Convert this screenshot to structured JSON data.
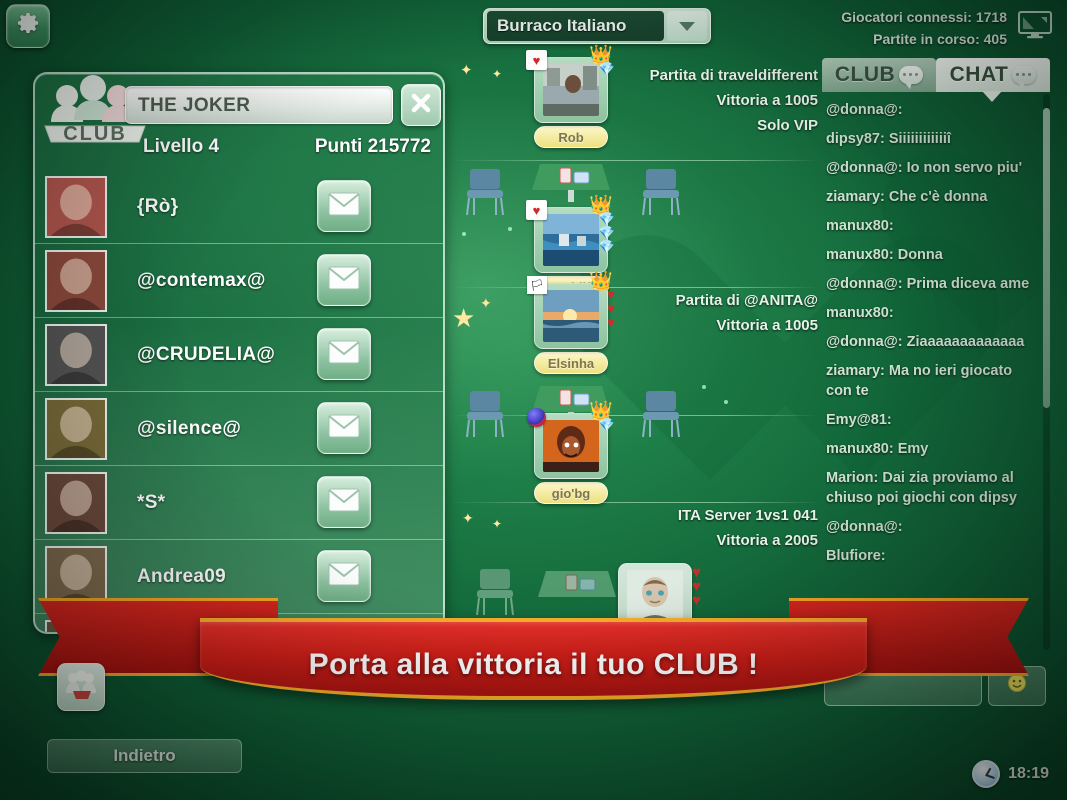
{
  "topbar": {
    "settings_icon": "gear-icon",
    "game_selector": {
      "value": "Burraco Italiano",
      "chevron_icon": "chevron-down-icon"
    },
    "stats": {
      "players_online": "Giocatori connessi: 1718",
      "games_running": "Partite in corso: 405"
    },
    "monitor_icon": "monitor-icon"
  },
  "club_panel": {
    "badge_label": "CLUB",
    "badge_icon": "club-people-icon",
    "club_name": "THE JOKER",
    "close_icon": "close-icon",
    "level": "Livello 4",
    "points": "Punti 215772",
    "mail_icon": "envelope-icon",
    "lamp_icon": "lamp-status-icon",
    "members": [
      {
        "name": "{Rò}",
        "online": true,
        "avatar_tone": "#b4584f"
      },
      {
        "name": "@contemax@",
        "online": false,
        "avatar_tone": "#8e4a3d"
      },
      {
        "name": "@CRUDELIA@",
        "online": true,
        "avatar_tone": "#555555"
      },
      {
        "name": "@silence@",
        "online": false,
        "avatar_tone": "#7a6c3a"
      },
      {
        "name": "*S*",
        "online": true,
        "avatar_tone": "#6b4a3c"
      },
      {
        "name": "Andrea09",
        "online": true,
        "avatar_tone": "#7d6a4e"
      },
      {
        "name": "",
        "online": false,
        "avatar_tone": "#6a5a44"
      }
    ]
  },
  "lobby": {
    "tables": [
      {
        "info": [
          "Partita di traveldifferent",
          "Vittoria a 1005",
          "Solo VIP"
        ],
        "host": {
          "name": "Rob",
          "crown": true,
          "heart_badge": true,
          "gems": [
            "gem"
          ],
          "avatar_tone": "#7f6f66"
        }
      },
      {
        "info": [],
        "host": {
          "name": "traveldiffe",
          "crown": true,
          "heart_badge": true,
          "gems": [
            "gem",
            "gem",
            "gem"
          ],
          "avatar_tone": "#2f6e9b"
        }
      },
      {
        "info": [
          "Partita di @ANITA@",
          "Vittoria a 1005"
        ],
        "host": {
          "name": "Elsinha",
          "crown": true,
          "flag_badge": true,
          "hearts": 3,
          "avatar_tone": "#c9702f"
        }
      },
      {
        "info": [],
        "host": {
          "name": "gio'bg",
          "crown": true,
          "ball_badge": true,
          "gems": [
            "gem"
          ],
          "avatar_tone": "#c2571e"
        }
      },
      {
        "info": [
          "ITA Server 1vs1 041",
          "Vittoria a 2005"
        ],
        "host": {
          "name": "",
          "hearts": 3,
          "avatar_tone": "#cfd8d0"
        }
      }
    ]
  },
  "chat_panel": {
    "tabs": [
      {
        "label": "CLUB",
        "icon": "chat-bubble-icon",
        "active": false
      },
      {
        "label": "CHAT",
        "icon": "chat-bubble-icon",
        "active": true
      }
    ],
    "messages": [
      "@donna@:",
      "dipsy87: Siiiiiiiiiiiiî",
      "@donna@: Io non servo piu'",
      "ziamary: Che c'è donna",
      "manux80:",
      "manux80: Donna",
      "@donna@: Prima diceva ame",
      "manux80:",
      "@donna@: Ziaaaaaaaaaaaaa",
      "ziamary: Ma no ieri giocato con te",
      "Emy@81:",
      "manux80: Emy",
      "Marion: Dai zia proviamo al chiuso poi giochi con dipsy",
      "@donna@:",
      "Blufiore:"
    ],
    "input_placeholder": "",
    "emoji_icon": "smiley-icon"
  },
  "ribbon": {
    "text": "Porta alla vittoria il tuo CLUB !"
  },
  "bottom": {
    "club_mini_icon": "club-people-icon",
    "back_label": "Indietro",
    "clock_icon": "clock-icon",
    "time": "18:19"
  },
  "colors": {
    "green_dark": "#05341d",
    "green_mid": "#1d8048",
    "ribbon_red": "#cf1f19",
    "ribbon_gold": "#f9ad28",
    "panel_border": "#d2eedc"
  }
}
